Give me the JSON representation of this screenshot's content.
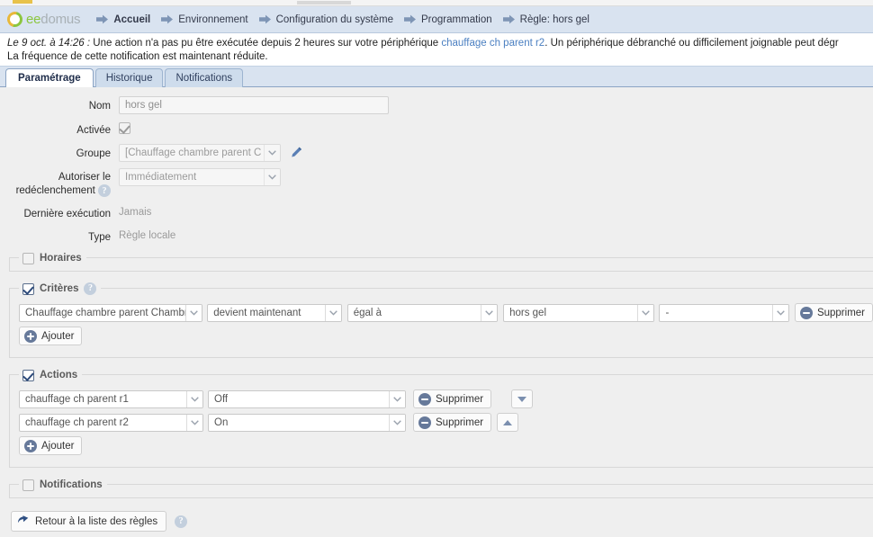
{
  "brand": {
    "name_part1": "ee",
    "name_part2": "domus"
  },
  "nav": {
    "items": [
      {
        "label": "Accueil",
        "bold": true
      },
      {
        "label": "Environnement",
        "bold": false
      },
      {
        "label": "Configuration du système",
        "bold": false
      },
      {
        "label": "Programmation",
        "bold": false
      },
      {
        "label": "Règle: hors gel",
        "bold": false
      }
    ]
  },
  "notice": {
    "date": "Le 9 oct. à 14:26 :",
    "text_before_link": " Une action n'a pas pu être exécutée depuis 2 heures sur votre périphérique ",
    "link": "chauffage ch parent r2",
    "text_after_link": ". Un périphérique débranché ou difficilement joignable peut dégr",
    "line2": "La fréquence de cette notification est maintenant réduite."
  },
  "tabs": [
    {
      "label": "Paramétrage",
      "active": true
    },
    {
      "label": "Historique",
      "active": false
    },
    {
      "label": "Notifications",
      "active": false
    }
  ],
  "form": {
    "nom": {
      "label": "Nom",
      "value": "hors gel"
    },
    "activee": {
      "label": "Activée",
      "checked": true
    },
    "groupe": {
      "label": "Groupe",
      "value": "[Chauffage chambre parent C"
    },
    "redeclenchement": {
      "label_line1": "Autoriser le",
      "label_line2": "redéclenchement",
      "value": "Immédiatement"
    },
    "derniere_execution": {
      "label": "Dernière exécution",
      "value": "Jamais"
    },
    "type": {
      "label": "Type",
      "value": "Règle locale"
    }
  },
  "sections": {
    "horaires": {
      "legend": "Horaires",
      "checked": false
    },
    "criteres": {
      "legend": "Critères",
      "checked": true,
      "rows": [
        {
          "device": "Chauffage chambre parent Chambr",
          "event": "devient maintenant",
          "operator": "égal à",
          "value": "hors gel",
          "extra": "-",
          "delete_label": "Supprimer"
        }
      ],
      "add_label": "Ajouter"
    },
    "actions": {
      "legend": "Actions",
      "checked": true,
      "rows": [
        {
          "device": "chauffage ch parent r1",
          "state": "Off",
          "delete_label": "Supprimer",
          "move": "down"
        },
        {
          "device": "chauffage ch parent r2",
          "state": "On",
          "delete_label": "Supprimer",
          "move": "up"
        }
      ],
      "add_label": "Ajouter"
    },
    "notifications": {
      "legend": "Notifications",
      "checked": false
    }
  },
  "footer": {
    "back_label": "Retour à la liste des règles"
  },
  "colors": {
    "nav_bg": "#d9e3f0",
    "link": "#4a7fc1",
    "page_bg": "#efefef",
    "icon_blue": "#66799a",
    "logo_yellow": "#e8b83a",
    "logo_green": "#8cc63f"
  }
}
